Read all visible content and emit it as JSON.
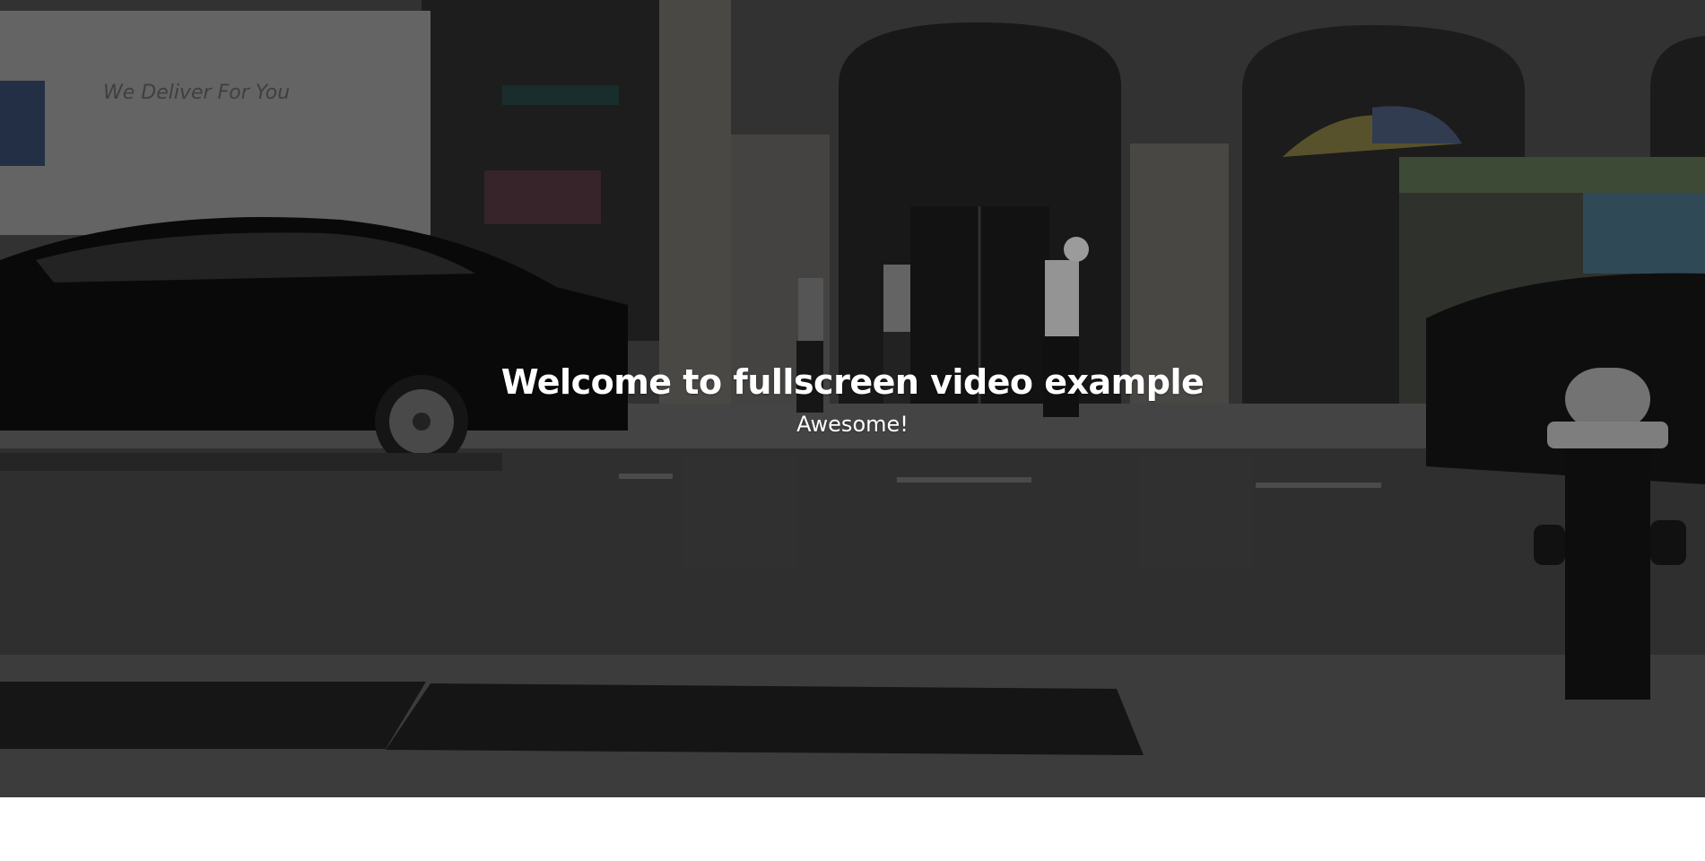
{
  "hero": {
    "title": "Welcome to fullscreen video example",
    "subtitle": "Awesome!",
    "background_video": "street-scene-video"
  },
  "background_truck_text": "We Deliver For You",
  "colors": {
    "text": "#ffffff",
    "page_background": "#ffffff",
    "video_tint": "#3b3b3c"
  }
}
